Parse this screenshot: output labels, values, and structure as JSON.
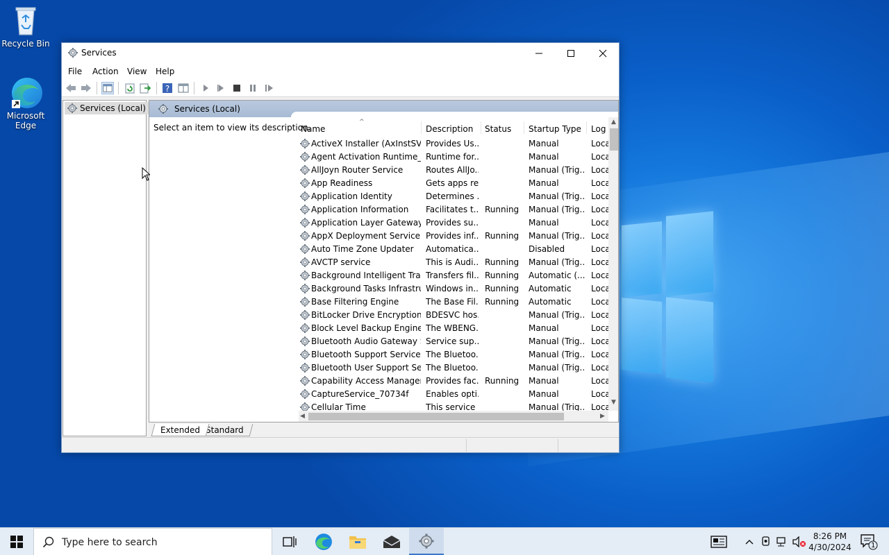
{
  "desktop": {
    "icons": [
      {
        "label": "Recycle Bin"
      },
      {
        "label": "Microsoft Edge"
      }
    ]
  },
  "window": {
    "title": "Services",
    "menu": [
      "File",
      "Action",
      "View",
      "Help"
    ],
    "tree_item": "Services (Local)",
    "pane_title": "Services (Local)",
    "description_hint": "Select an item to view its description.",
    "columns": [
      "Name",
      "Description",
      "Status",
      "Startup Type",
      "Log"
    ],
    "rows": [
      {
        "name": "ActiveX Installer (AxInstSV)",
        "desc": "Provides Us...",
        "status": "",
        "startup": "Manual",
        "log": "Loca"
      },
      {
        "name": "Agent Activation Runtime_...",
        "desc": "Runtime for...",
        "status": "",
        "startup": "Manual",
        "log": "Loca"
      },
      {
        "name": "AllJoyn Router Service",
        "desc": "Routes AllJo...",
        "status": "",
        "startup": "Manual (Trig...",
        "log": "Loca"
      },
      {
        "name": "App Readiness",
        "desc": "Gets apps re...",
        "status": "",
        "startup": "Manual",
        "log": "Loca"
      },
      {
        "name": "Application Identity",
        "desc": "Determines ...",
        "status": "",
        "startup": "Manual (Trig...",
        "log": "Loca"
      },
      {
        "name": "Application Information",
        "desc": "Facilitates t...",
        "status": "Running",
        "startup": "Manual (Trig...",
        "log": "Loca"
      },
      {
        "name": "Application Layer Gateway ...",
        "desc": "Provides su...",
        "status": "",
        "startup": "Manual",
        "log": "Loca"
      },
      {
        "name": "AppX Deployment Service (...",
        "desc": "Provides inf...",
        "status": "Running",
        "startup": "Manual (Trig...",
        "log": "Loca"
      },
      {
        "name": "Auto Time Zone Updater",
        "desc": "Automatica...",
        "status": "",
        "startup": "Disabled",
        "log": "Loca"
      },
      {
        "name": "AVCTP service",
        "desc": "This is Audi...",
        "status": "Running",
        "startup": "Manual (Trig...",
        "log": "Loca"
      },
      {
        "name": "Background Intelligent Tran...",
        "desc": "Transfers fil...",
        "status": "Running",
        "startup": "Automatic (...",
        "log": "Loca"
      },
      {
        "name": "Background Tasks Infrastruc...",
        "desc": "Windows in...",
        "status": "Running",
        "startup": "Automatic",
        "log": "Loca"
      },
      {
        "name": "Base Filtering Engine",
        "desc": "The Base Fil...",
        "status": "Running",
        "startup": "Automatic",
        "log": "Loca"
      },
      {
        "name": "BitLocker Drive Encryption ...",
        "desc": "BDESVC hos...",
        "status": "",
        "startup": "Manual (Trig...",
        "log": "Loca"
      },
      {
        "name": "Block Level Backup Engine ...",
        "desc": "The WBENG...",
        "status": "",
        "startup": "Manual",
        "log": "Loca"
      },
      {
        "name": "Bluetooth Audio Gateway S...",
        "desc": "Service sup...",
        "status": "",
        "startup": "Manual (Trig...",
        "log": "Loca"
      },
      {
        "name": "Bluetooth Support Service",
        "desc": "The Bluetoo...",
        "status": "",
        "startup": "Manual (Trig...",
        "log": "Loca"
      },
      {
        "name": "Bluetooth User Support Ser...",
        "desc": "The Bluetoo...",
        "status": "",
        "startup": "Manual (Trig...",
        "log": "Loca"
      },
      {
        "name": "Capability Access Manager ...",
        "desc": "Provides fac...",
        "status": "Running",
        "startup": "Manual",
        "log": "Loca"
      },
      {
        "name": "CaptureService_70734f",
        "desc": "Enables opti...",
        "status": "",
        "startup": "Manual",
        "log": "Loca"
      },
      {
        "name": "Cellular Time",
        "desc": "This service ...",
        "status": "",
        "startup": "Manual (Trig...",
        "log": "Loca"
      }
    ],
    "tabs": [
      "Extended",
      "Standard"
    ]
  },
  "taskbar": {
    "search_placeholder": "Type here to search",
    "time": "8:26 PM",
    "date": "4/30/2024",
    "notification_count": "1"
  }
}
